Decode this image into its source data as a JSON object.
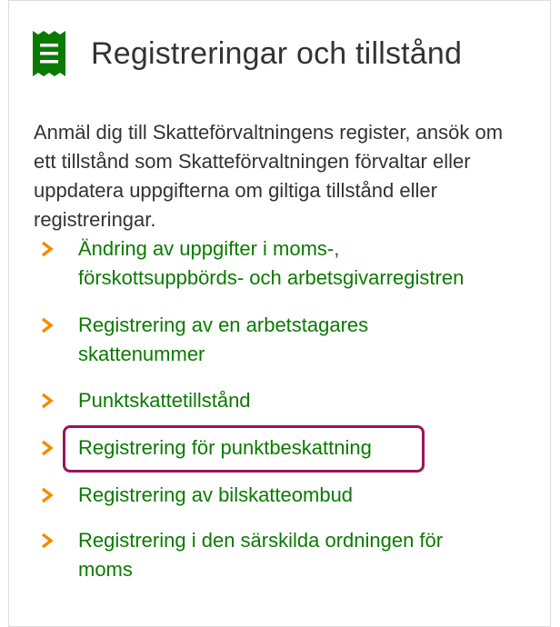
{
  "section": {
    "icon": "document-list-icon",
    "title": "Registreringar och tillstånd",
    "intro": "Anmäl dig till Skatteförvaltningens register, ansök om ett tillstånd som Skatteförvaltningen förvaltar eller uppdatera uppgifterna om giltiga tillstånd eller registreringar."
  },
  "links": [
    {
      "label_line1": "Ändring av uppgifter i moms-,",
      "label_line2": "förskottsuppbörds- och arbetsgivarregistren",
      "icon": "chevron-right-icon"
    },
    {
      "label_line1": "Registrering av en arbetstagares",
      "label_line2": "skattenummer",
      "icon": "chevron-right-icon"
    },
    {
      "label_line1": "Punktskattetillstånd",
      "icon": "chevron-right-icon"
    },
    {
      "label_line1": "Registrering för punktbeskattning",
      "icon": "chevron-right-icon",
      "highlighted": true
    },
    {
      "label_line1": "Registrering av bilskatteombud",
      "icon": "chevron-right-icon"
    },
    {
      "label_line1": "Registrering i den särskilda ordningen för",
      "label_line2": "moms",
      "icon": "chevron-right-icon"
    }
  ],
  "colors": {
    "icon_green": "#0a7a00",
    "link_green": "#0a7a00",
    "chevron_orange": "#f28c00",
    "highlight_border": "#9b145a",
    "text": "#333333"
  }
}
